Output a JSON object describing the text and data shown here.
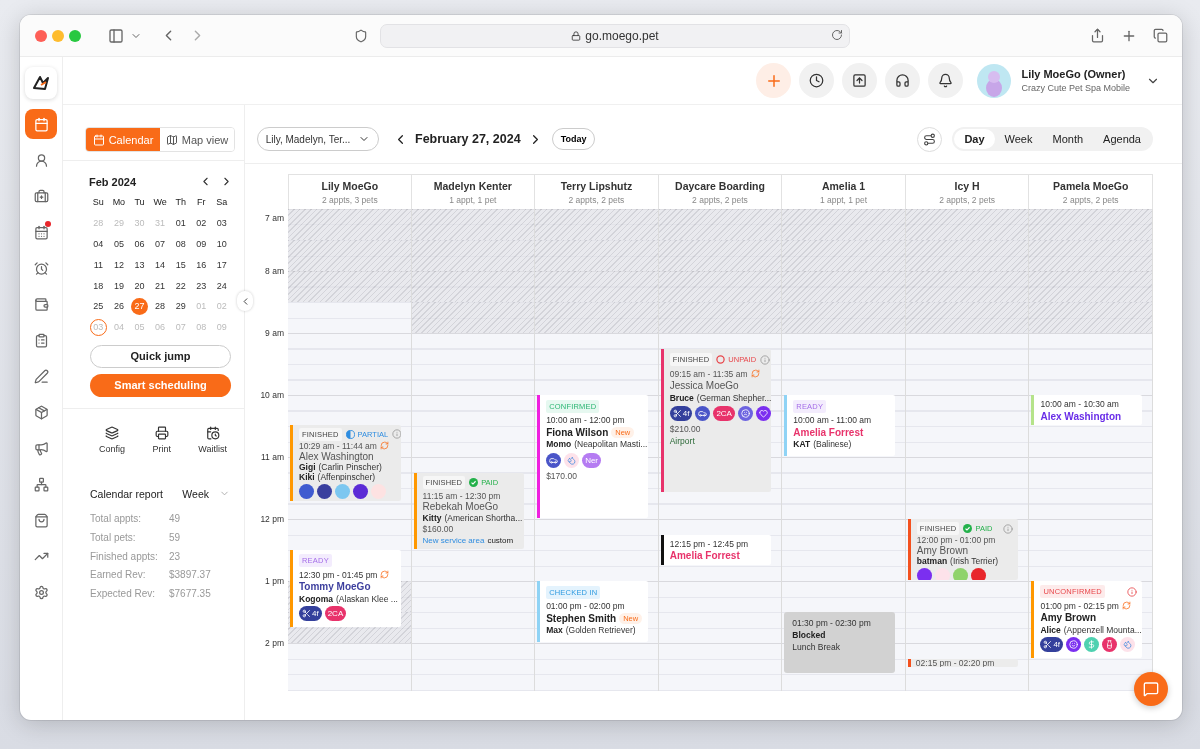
{
  "browser": {
    "url": "go.moego.pet"
  },
  "nav": [
    {
      "kind": "logo"
    },
    {
      "kind": "calendar",
      "selected": true,
      "badge": false
    },
    {
      "kind": "clients",
      "selected": false,
      "badge": false
    },
    {
      "kind": "kit",
      "selected": false,
      "badge": false
    },
    {
      "kind": "booking",
      "selected": false,
      "badge": true
    },
    {
      "kind": "alarm",
      "selected": false,
      "badge": false
    },
    {
      "kind": "wallet",
      "selected": false,
      "badge": false
    },
    {
      "kind": "clipboard",
      "selected": false,
      "badge": false
    },
    {
      "kind": "pen",
      "selected": false,
      "badge": false
    },
    {
      "kind": "ticket",
      "selected": false,
      "badge": false
    },
    {
      "kind": "megaphone",
      "selected": false,
      "badge": false
    },
    {
      "kind": "network",
      "selected": false,
      "badge": false
    },
    {
      "kind": "bag",
      "selected": false,
      "badge": false
    },
    {
      "kind": "chart",
      "selected": false,
      "badge": false
    },
    {
      "kind": "settings",
      "selected": false,
      "badge": false
    }
  ],
  "header": {
    "actions": [
      {
        "kind": "add"
      },
      {
        "kind": "clock"
      },
      {
        "kind": "upload"
      },
      {
        "kind": "support"
      },
      {
        "kind": "bell"
      }
    ],
    "user": "Lily MoeGo (Owner)",
    "business": "Crazy Cute Pet Spa Mobile"
  },
  "view_switch": [
    {
      "kind": "calendar",
      "label": "Calendar",
      "selected": true
    },
    {
      "kind": "map",
      "label": "Map view",
      "selected": false
    }
  ],
  "mini_calendar": {
    "month": "Feb 2024",
    "weekdays": [
      "Su",
      "Mo",
      "Tu",
      "We",
      "Th",
      "Fr",
      "Sa"
    ],
    "days": [
      {
        "d": "28",
        "outside": true,
        "selected": false,
        "circled": false
      },
      {
        "d": "29",
        "outside": true,
        "selected": false,
        "circled": false
      },
      {
        "d": "30",
        "outside": true,
        "selected": false,
        "circled": false
      },
      {
        "d": "31",
        "outside": true,
        "selected": false,
        "circled": false
      },
      {
        "d": "01",
        "outside": false,
        "selected": false,
        "circled": false
      },
      {
        "d": "02",
        "outside": false,
        "selected": false,
        "circled": false
      },
      {
        "d": "03",
        "outside": false,
        "selected": false,
        "circled": false
      },
      {
        "d": "04",
        "outside": false,
        "selected": false,
        "circled": false
      },
      {
        "d": "05",
        "outside": false,
        "selected": false,
        "circled": false
      },
      {
        "d": "06",
        "outside": false,
        "selected": false,
        "circled": false
      },
      {
        "d": "07",
        "outside": false,
        "selected": false,
        "circled": false
      },
      {
        "d": "08",
        "outside": false,
        "selected": false,
        "circled": false
      },
      {
        "d": "09",
        "outside": false,
        "selected": false,
        "circled": false
      },
      {
        "d": "10",
        "outside": false,
        "selected": false,
        "circled": false
      },
      {
        "d": "11",
        "outside": false,
        "selected": false,
        "circled": false
      },
      {
        "d": "12",
        "outside": false,
        "selected": false,
        "circled": false
      },
      {
        "d": "13",
        "outside": false,
        "selected": false,
        "circled": false
      },
      {
        "d": "14",
        "outside": false,
        "selected": false,
        "circled": false
      },
      {
        "d": "15",
        "outside": false,
        "selected": false,
        "circled": false
      },
      {
        "d": "16",
        "outside": false,
        "selected": false,
        "circled": false
      },
      {
        "d": "17",
        "outside": false,
        "selected": false,
        "circled": false
      },
      {
        "d": "18",
        "outside": false,
        "selected": false,
        "circled": false
      },
      {
        "d": "19",
        "outside": false,
        "selected": false,
        "circled": false
      },
      {
        "d": "20",
        "outside": false,
        "selected": false,
        "circled": false
      },
      {
        "d": "21",
        "outside": false,
        "selected": false,
        "circled": false
      },
      {
        "d": "22",
        "outside": false,
        "selected": false,
        "circled": false
      },
      {
        "d": "23",
        "outside": false,
        "selected": false,
        "circled": false
      },
      {
        "d": "24",
        "outside": false,
        "selected": false,
        "circled": false
      },
      {
        "d": "25",
        "outside": false,
        "selected": false,
        "circled": false
      },
      {
        "d": "26",
        "outside": false,
        "selected": false,
        "circled": false
      },
      {
        "d": "27",
        "outside": false,
        "selected": true,
        "circled": false
      },
      {
        "d": "28",
        "outside": false,
        "selected": false,
        "circled": false
      },
      {
        "d": "29",
        "outside": false,
        "selected": false,
        "circled": false
      },
      {
        "d": "01",
        "outside": true,
        "selected": false,
        "circled": false
      },
      {
        "d": "02",
        "outside": true,
        "selected": false,
        "circled": false
      },
      {
        "d": "03",
        "outside": true,
        "selected": false,
        "circled": true
      },
      {
        "d": "04",
        "outside": true,
        "selected": false,
        "circled": false
      },
      {
        "d": "05",
        "outside": true,
        "selected": false,
        "circled": false
      },
      {
        "d": "06",
        "outside": true,
        "selected": false,
        "circled": false
      },
      {
        "d": "07",
        "outside": true,
        "selected": false,
        "circled": false
      },
      {
        "d": "08",
        "outside": true,
        "selected": false,
        "circled": false
      },
      {
        "d": "09",
        "outside": true,
        "selected": false,
        "circled": false
      }
    ]
  },
  "quick_jump": "Quick jump",
  "smart_scheduling": "Smart scheduling",
  "tools": [
    {
      "kind": "config",
      "label": "Config"
    },
    {
      "kind": "print",
      "label": "Print"
    },
    {
      "kind": "waitlist",
      "label": "Waitlist"
    }
  ],
  "report": {
    "title": "Calendar report",
    "period": "Week",
    "stats": [
      {
        "label": "Total appts:",
        "value": "49"
      },
      {
        "label": "Total pets:",
        "value": "59"
      },
      {
        "label": "Finished appts:",
        "value": "23"
      },
      {
        "label": "Earned Rev:",
        "value": "$3897.37"
      },
      {
        "label": "Expected Rev:",
        "value": "$7677.35"
      }
    ]
  },
  "toolbar": {
    "staff": "Lily, Madelyn, Ter...",
    "date": "February 27, 2024",
    "today": "Today",
    "views": [
      {
        "label": "Day",
        "selected": true
      },
      {
        "label": "Week",
        "selected": false
      },
      {
        "label": "Month",
        "selected": false
      },
      {
        "label": "Agenda",
        "selected": false
      }
    ]
  },
  "hours": [
    "7 am",
    "8 am",
    "9 am",
    "10 am",
    "11 am",
    "12 pm",
    "1 pm",
    "2 pm"
  ],
  "columns": [
    {
      "name": "Lily MoeGo",
      "summary": "2 appts, 3 pets",
      "hatched": [
        true,
        true,
        true,
        false,
        false,
        false,
        false,
        false,
        false,
        false,
        false,
        false,
        true,
        true,
        false,
        false
      ],
      "events": [
        {
          "kind": "appointment",
          "color": "#ff9800",
          "status": {
            "label": "FINISHED",
            "kind": "finished"
          },
          "payment": {
            "label": "PARTIAL",
            "kind": "partial"
          },
          "info": true,
          "time": "10:29 am - 11:44 am",
          "repeat": true,
          "client": {
            "text": "Alex Washington",
            "color": "#555555"
          },
          "pets": [
            {
              "name": "Gigi",
              "breed": "(Carlin Pinscher)"
            },
            {
              "name": "Kiki",
              "breed": "(Affenpinscher)"
            }
          ],
          "tags": [
            {
              "kind": "plain",
              "color": "#3f5bd0"
            },
            {
              "kind": "plain",
              "color": "#3a3f9e"
            },
            {
              "kind": "plain",
              "color": "#7cc7f0"
            },
            {
              "kind": "plain",
              "color": "#5b2bd6"
            },
            {
              "kind": "plain",
              "color": "#fde2e2"
            }
          ]
        },
        {
          "kind": "appointment",
          "color": "#ff9800",
          "status": {
            "label": "READY",
            "kind": "ready"
          },
          "time": "12:30 pm - 01:45 pm",
          "repeat": true,
          "client": {
            "text": "Tommy MoeGo",
            "color": "#3d3f9e"
          },
          "pets": [
            {
              "name": "Kogoma",
              "breed": "(Alaskan Klee ..."
            }
          ],
          "tags": [
            {
              "kind": "groom",
              "label": "4f",
              "color": "#34409c"
            },
            {
              "kind": "text",
              "label": "2CA",
              "color": "#e8336b"
            }
          ]
        }
      ]
    },
    {
      "name": "Madelyn Kenter",
      "summary": "1 appt, 1 pet",
      "hatched": [
        true,
        true,
        true,
        true,
        false,
        false,
        false,
        false,
        false,
        false,
        false,
        false,
        false,
        false,
        false,
        false
      ],
      "events": [
        {
          "kind": "appointment",
          "color": "#ff9800",
          "status": {
            "label": "FINISHED",
            "kind": "finished"
          },
          "payment": {
            "label": "PAID",
            "kind": "paid"
          },
          "time": "11:15 am - 12:30 pm",
          "repeat": false,
          "client": {
            "text": "Rebekah MoeGo",
            "color": "#555555"
          },
          "pets": [
            {
              "name": "Kitty",
              "breed": "(American Shortha..."
            }
          ],
          "price": "$160.00",
          "area": "New service area",
          "area_note": "custom"
        }
      ]
    },
    {
      "name": "Terry Lipshutz",
      "summary": "2 appts, 2 pets",
      "hatched": [
        true,
        true,
        true,
        true,
        false,
        false,
        false,
        false,
        false,
        false,
        false,
        false,
        false,
        false,
        false,
        false
      ],
      "events": [
        {
          "kind": "appointment",
          "color": "#f01fe0",
          "status": {
            "label": "CONFIRMED",
            "kind": "confirmed"
          },
          "time": "10:00 am - 12:00 pm",
          "repeat": false,
          "client": {
            "text": "Fiona Wilson",
            "color": "#222222"
          },
          "new_badge": "New",
          "pets": [
            {
              "name": "Momo",
              "breed": "(Neapolitan Masti..."
            }
          ],
          "tags": [
            {
              "kind": "car",
              "color": "#4a55c8"
            },
            {
              "kind": "bubbles",
              "color": "#fde2ea"
            },
            {
              "kind": "text",
              "label": "Ner",
              "color": "#b57cf2"
            }
          ],
          "price": "$170.00"
        },
        {
          "kind": "appointment",
          "color": "#8fd3f5",
          "status": {
            "label": "CHECKED IN",
            "kind": "checked_in"
          },
          "time": "01:00 pm - 02:00 pm",
          "repeat": false,
          "client": {
            "text": "Stephen Smith",
            "color": "#222222"
          },
          "new_badge": "New",
          "pets": [
            {
              "name": "Max",
              "breed": "(Golden Retriever)"
            }
          ]
        }
      ]
    },
    {
      "name": "Daycare Boarding",
      "summary": "2 appts, 2 pets",
      "hatched": [
        true,
        true,
        true,
        true,
        false,
        false,
        false,
        false,
        false,
        false,
        false,
        false,
        false,
        false,
        false,
        false
      ],
      "events": [
        {
          "kind": "appointment",
          "color": "#e8336b",
          "status": {
            "label": "FINISHED",
            "kind": "finished"
          },
          "payment": {
            "label": "UNPAID",
            "kind": "unpaid"
          },
          "info": true,
          "time": "09:15 am - 11:35 am",
          "repeat": true,
          "client": {
            "text": "Jessica MoeGo",
            "color": "#555555"
          },
          "pets": [
            {
              "name": "Bruce",
              "breed": "(German Shepher..."
            }
          ],
          "tags": [
            {
              "kind": "groom",
              "label": "4f",
              "color": "#34409c"
            },
            {
              "kind": "car",
              "color": "#4a55c8"
            },
            {
              "kind": "text",
              "label": "2CA",
              "color": "#e8336b"
            },
            {
              "kind": "face",
              "color": "#6c63e0"
            },
            {
              "kind": "heart",
              "color": "#7b2ff0"
            }
          ],
          "price": "$210.00",
          "note": "Airport"
        },
        {
          "kind": "brief",
          "color": "#111111",
          "time": "12:15 pm - 12:45 pm",
          "repeat": false,
          "client": {
            "text": "Amelia Forrest",
            "color": "#e8336b"
          }
        }
      ]
    },
    {
      "name": "Amelia 1",
      "summary": "1 appt, 1 pet",
      "hatched": [
        true,
        true,
        true,
        true,
        false,
        false,
        false,
        false,
        false,
        false,
        false,
        false,
        false,
        false,
        false,
        false
      ],
      "events": [
        {
          "kind": "appointment",
          "color": "#8fd3f5",
          "status": {
            "label": "READY",
            "kind": "ready"
          },
          "time": "10:00 am - 11:00 am",
          "repeat": false,
          "client": {
            "text": "Amelia Forrest",
            "color": "#e8336b"
          },
          "pets": [
            {
              "name": "KAT",
              "breed": "(Balinese)"
            }
          ]
        },
        {
          "kind": "blocked",
          "time": "01:30 pm - 02:30 pm",
          "title": "Blocked",
          "note": "Lunch Break"
        }
      ]
    },
    {
      "name": "Icy H",
      "summary": "2 appts, 2 pets",
      "hatched": [
        true,
        true,
        true,
        true,
        false,
        false,
        false,
        false,
        false,
        false,
        false,
        false,
        false,
        false,
        false,
        false
      ],
      "events": [
        {
          "kind": "appointment",
          "color": "#f4511e",
          "status": {
            "label": "FINISHED",
            "kind": "finished"
          },
          "payment": {
            "label": "PAID",
            "kind": "paid"
          },
          "info": true,
          "time": "12:00 pm - 01:00 pm",
          "repeat": false,
          "client": {
            "text": "Amy Brown",
            "color": "#555555"
          },
          "pets": [
            {
              "name": "batman",
              "breed": "(Irish Terrier)"
            }
          ],
          "tags": [
            {
              "kind": "plain",
              "color": "#7b2ff0"
            },
            {
              "kind": "plain",
              "color": "#fde2ea"
            },
            {
              "kind": "plain",
              "color": "#8fd36b"
            },
            {
              "kind": "plain",
              "color": "#e8262b"
            }
          ]
        },
        {
          "kind": "bar",
          "color": "#f4511e",
          "time": "02:15 pm - 02:20 pm"
        }
      ]
    },
    {
      "name": "Pamela MoeGo",
      "summary": "2 appts, 2 pets",
      "hatched": [
        true,
        true,
        true,
        true,
        false,
        false,
        false,
        false,
        false,
        false,
        false,
        false,
        false,
        false,
        false,
        false
      ],
      "events": [
        {
          "kind": "brief",
          "color": "#b5e38a",
          "time": "10:00 am - 10:30 am",
          "repeat": false,
          "client": {
            "text": "Alex Washington",
            "color": "#6a2ee8"
          }
        },
        {
          "kind": "appointment",
          "color": "#ff9800",
          "status": {
            "label": "UNCONFIRMED",
            "kind": "unconfirmed"
          },
          "info": true,
          "time": "01:00 pm - 02:15 pm",
          "repeat": true,
          "client": {
            "text": "Amy Brown",
            "color": "#222222"
          },
          "pets": [
            {
              "name": "Alice",
              "breed": "(Appenzell Mounta..."
            }
          ],
          "tags": [
            {
              "kind": "groom",
              "label": "4f",
              "color": "#34409c"
            },
            {
              "kind": "smile",
              "color": "#7b2ff0"
            },
            {
              "kind": "money",
              "color": "#4fd1b0"
            },
            {
              "kind": "bottle",
              "color": "#e8336b"
            },
            {
              "kind": "bubbles",
              "color": "#fde2ea"
            }
          ]
        }
      ]
    }
  ]
}
